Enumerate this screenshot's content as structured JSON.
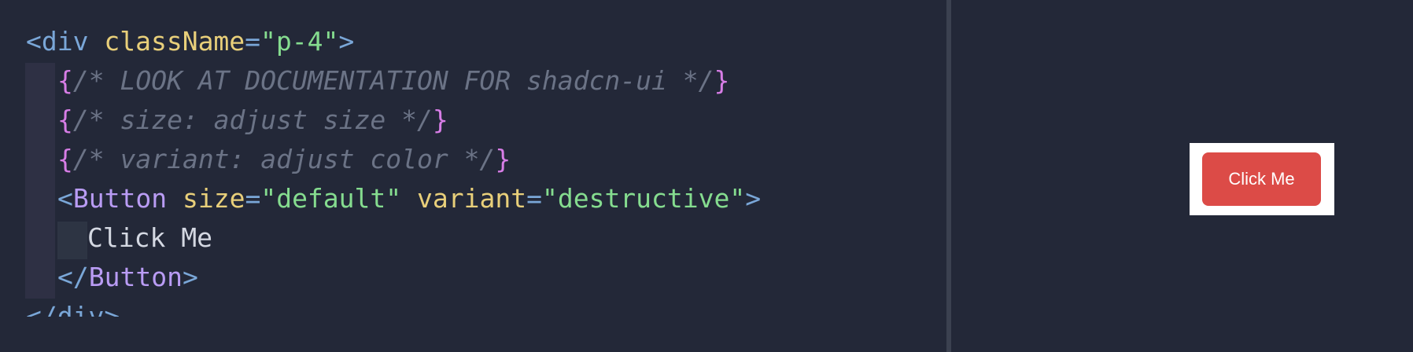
{
  "editor": {
    "lines": [
      {
        "tokens": [
          {
            "text": "<",
            "kind": "tag-punct"
          },
          {
            "text": "div",
            "kind": "tag"
          },
          {
            "text": " ",
            "kind": "text"
          },
          {
            "text": "className",
            "kind": "attr"
          },
          {
            "text": "=",
            "kind": "eq"
          },
          {
            "text": "\"p-4\"",
            "kind": "str"
          },
          {
            "text": ">",
            "kind": "tag-punct"
          }
        ]
      },
      {
        "tokens": [
          {
            "text": "{",
            "kind": "brace"
          },
          {
            "text": "/* LOOK AT DOCUMENTATION FOR shadcn-ui */",
            "kind": "comment"
          },
          {
            "text": "}",
            "kind": "brace"
          }
        ]
      },
      {
        "tokens": [
          {
            "text": "{",
            "kind": "brace"
          },
          {
            "text": "/* size: adjust size */",
            "kind": "comment"
          },
          {
            "text": "}",
            "kind": "brace"
          }
        ]
      },
      {
        "tokens": [
          {
            "text": "{",
            "kind": "brace"
          },
          {
            "text": "/* variant: adjust color */",
            "kind": "comment"
          },
          {
            "text": "}",
            "kind": "brace"
          }
        ]
      },
      {
        "tokens": [
          {
            "text": "<",
            "kind": "tag-punct"
          },
          {
            "text": "Button",
            "kind": "comp"
          },
          {
            "text": " ",
            "kind": "text"
          },
          {
            "text": "size",
            "kind": "attr"
          },
          {
            "text": "=",
            "kind": "eq"
          },
          {
            "text": "\"default\"",
            "kind": "str"
          },
          {
            "text": " ",
            "kind": "text"
          },
          {
            "text": "variant",
            "kind": "attr"
          },
          {
            "text": "=",
            "kind": "eq"
          },
          {
            "text": "\"destructive\"",
            "kind": "str"
          },
          {
            "text": ">",
            "kind": "tag-punct"
          }
        ]
      },
      {
        "tokens": [
          {
            "text": "Click Me",
            "kind": "text"
          }
        ]
      },
      {
        "tokens": [
          {
            "text": "</",
            "kind": "tag-punct"
          },
          {
            "text": "Button",
            "kind": "comp"
          },
          {
            "text": ">",
            "kind": "tag-punct"
          }
        ]
      },
      {
        "tokens": [
          {
            "text": "</",
            "kind": "tag-punct"
          },
          {
            "text": "div",
            "kind": "tag"
          },
          {
            "text": ">",
            "kind": "tag-punct"
          }
        ]
      }
    ]
  },
  "preview": {
    "button_label": "Click Me",
    "button_color": "#dc4b47"
  }
}
